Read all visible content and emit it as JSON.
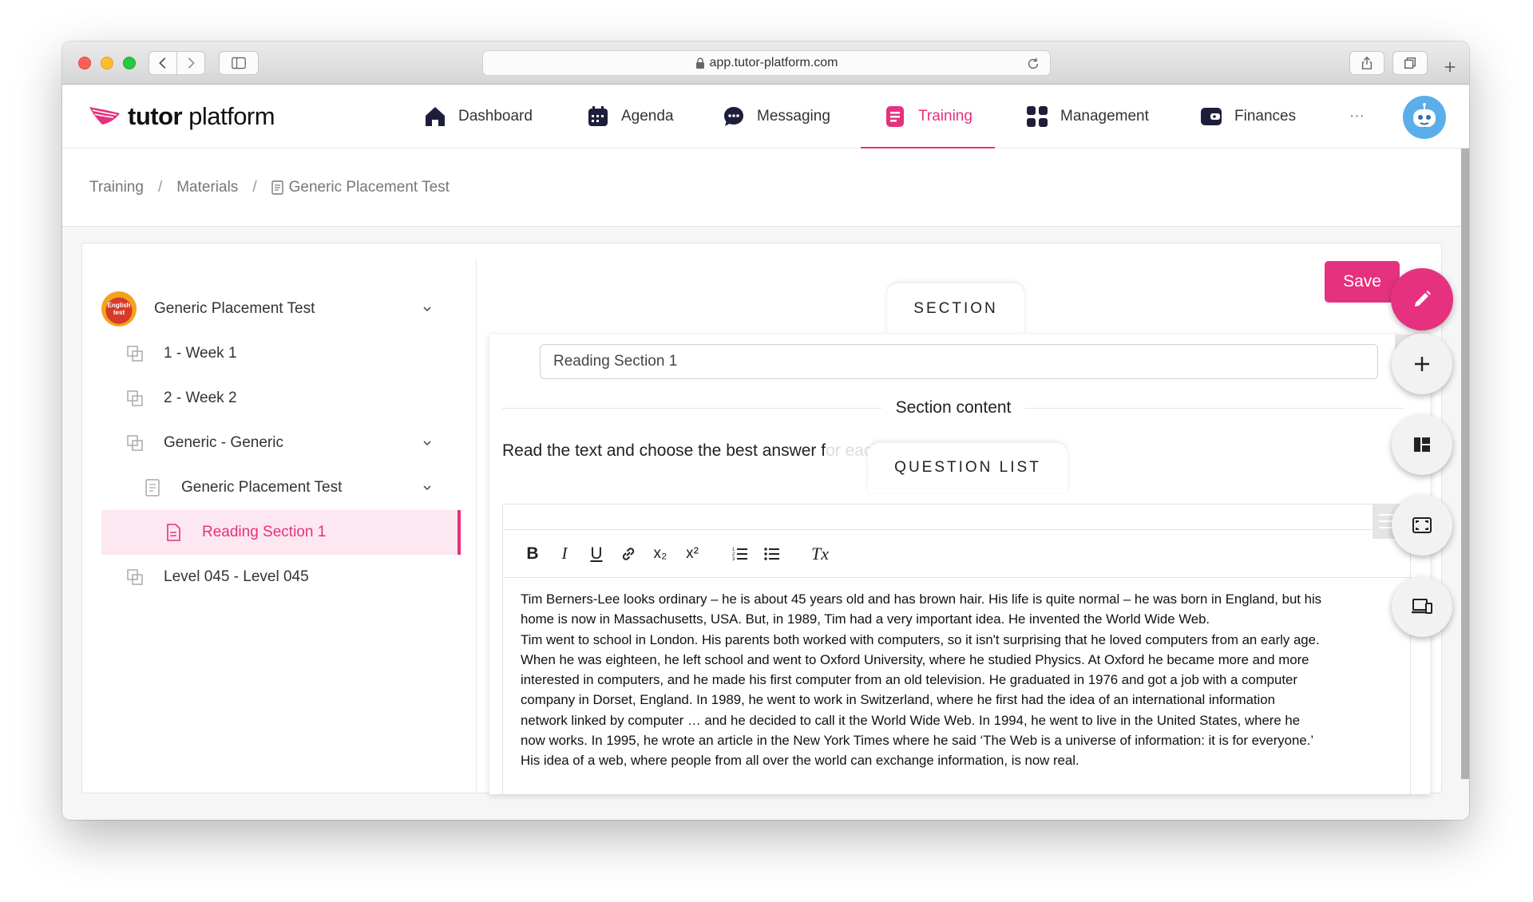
{
  "browser": {
    "url": "app.tutor-platform.com"
  },
  "brand": {
    "name_bold": "tutor",
    "name_light": "platform",
    "accent_color": "#e5317e"
  },
  "nav": {
    "items": [
      {
        "label": "Dashboard",
        "icon": "home-icon"
      },
      {
        "label": "Agenda",
        "icon": "calendar-icon"
      },
      {
        "label": "Messaging",
        "icon": "chat-icon"
      },
      {
        "label": "Training",
        "icon": "document-icon",
        "active": true
      },
      {
        "label": "Management",
        "icon": "grid-icon"
      },
      {
        "label": "Finances",
        "icon": "wallet-icon"
      }
    ],
    "more_label": "···"
  },
  "breadcrumb": {
    "items": [
      "Training",
      "Materials",
      "Generic Placement Test"
    ],
    "separator": "/"
  },
  "tree": {
    "items": [
      {
        "label": "Generic Placement Test",
        "logo_text": "English test",
        "expanded": true
      },
      {
        "label": "1 - Week 1"
      },
      {
        "label": "2 - Week 2"
      },
      {
        "label": "Generic - Generic",
        "expanded": true
      },
      {
        "label": "Generic Placement Test",
        "expanded": true
      },
      {
        "label": "Reading Section 1",
        "active": true
      },
      {
        "label": "Level 045 - Level 045"
      }
    ]
  },
  "editor": {
    "save_label": "Save",
    "section_tab": "SECTION",
    "section_name_value": "Reading Section 1",
    "section_content_label": "Section content",
    "instruction_visible": "Read the text and choose the best answer f",
    "instruction_hidden": "or each question.",
    "question_list_tab": "QUESTION LIST",
    "toolbar": {
      "bold": "B",
      "italic": "I",
      "underline": "U",
      "subscript": "x₂",
      "superscript": "x²",
      "clear_format": "Tx"
    },
    "body_lines": [
      "Tim Berners-Lee looks ordinary – he is about 45 years old and has brown hair. His life is quite normal – he was born in England, but his",
      "home is now in Massachusetts, USA. But, in 1989, Tim had a very important idea. He invented the World Wide Web.",
      "Tim went to school in London. His parents both worked with computers, so it isn't surprising that he loved computers from an early age.",
      "When he was eighteen, he left school and went to Oxford University, where he studied Physics. At Oxford he became more and more",
      "interested in computers, and he made his first computer from an old television. He graduated in 1976 and got a job with a computer",
      "company in Dorset, England. In 1989, he went to work in Switzerland, where he first had the idea of an international information",
      "network linked by computer … and he decided to call it the World Wide Web. In 1994, he went to live in the United States, where he",
      "now works. In 1995, he wrote an article in the New York Times where he said ‘The Web is a universe of information: it is for everyone.’",
      "His idea of a web, where people from all over the world can exchange information, is now real."
    ]
  }
}
